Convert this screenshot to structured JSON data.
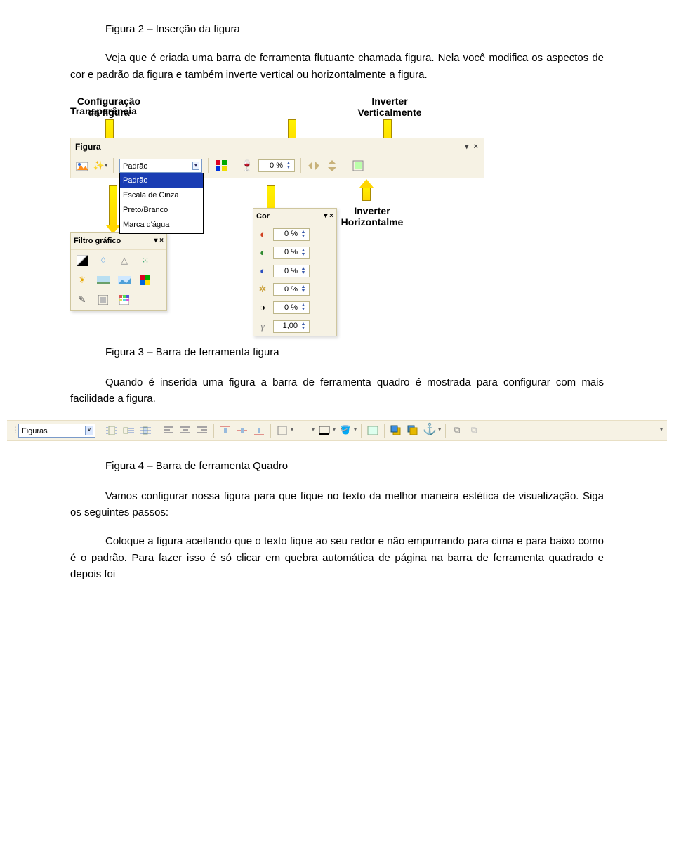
{
  "caption_fig2": "Figura 2 – Inserção da figura",
  "p1": "Veja que é criada uma barra de ferramenta flutuante chamada figura. Nela você modifica os aspectos de cor e padrão da figura e também inverte vertical ou horizontalmente a figura.",
  "labels": {
    "config": "Configuração\nda figura",
    "transp": "Transparência",
    "inv_v": "Inverter\nVerticalmente",
    "inv_h": "Inverter\nHorizontalme"
  },
  "figura_bar": {
    "title": "Figura",
    "selected": "Padrão",
    "options": [
      "Padrão",
      "Escala de Cinza",
      "Preto/Branco",
      "Marca d'água"
    ],
    "transparency": "0 %"
  },
  "filtro": {
    "title": "Filtro gráfico"
  },
  "cor": {
    "title": "Cor",
    "rows": [
      {
        "glyph": "◐",
        "color": "#d04020",
        "val": "0 %"
      },
      {
        "glyph": "◐",
        "color": "#2f8a2f",
        "val": "0 %"
      },
      {
        "glyph": "◐",
        "color": "#2b4fbf",
        "val": "0 %"
      },
      {
        "glyph": "✲",
        "color": "#caa038",
        "val": "0 %"
      },
      {
        "glyph": "◑",
        "color": "#000",
        "val": "0 %"
      },
      {
        "glyph": "γ",
        "color": "#7d7d7d",
        "val": "1,00"
      }
    ]
  },
  "caption_fig3": "Figura 3 – Barra de ferramenta figura",
  "p2": "Quando é inserida uma figura a barra de ferramenta quadro é mostrada para configurar com mais facilidade a figura.",
  "strip": {
    "selected": "Figuras"
  },
  "caption_fig4": "Figura 4 – Barra de ferramenta Quadro",
  "p3": "Vamos configurar nossa figura para que fique no texto da melhor maneira estética de visualização. Siga os seguintes passos:",
  "p4": "Coloque a figura aceitando que o texto fique ao seu redor e não empurrando para cima e para baixo como é o padrão. Para fazer isso é só clicar em quebra automática de página na barra de ferramenta quadrado e depois foi"
}
